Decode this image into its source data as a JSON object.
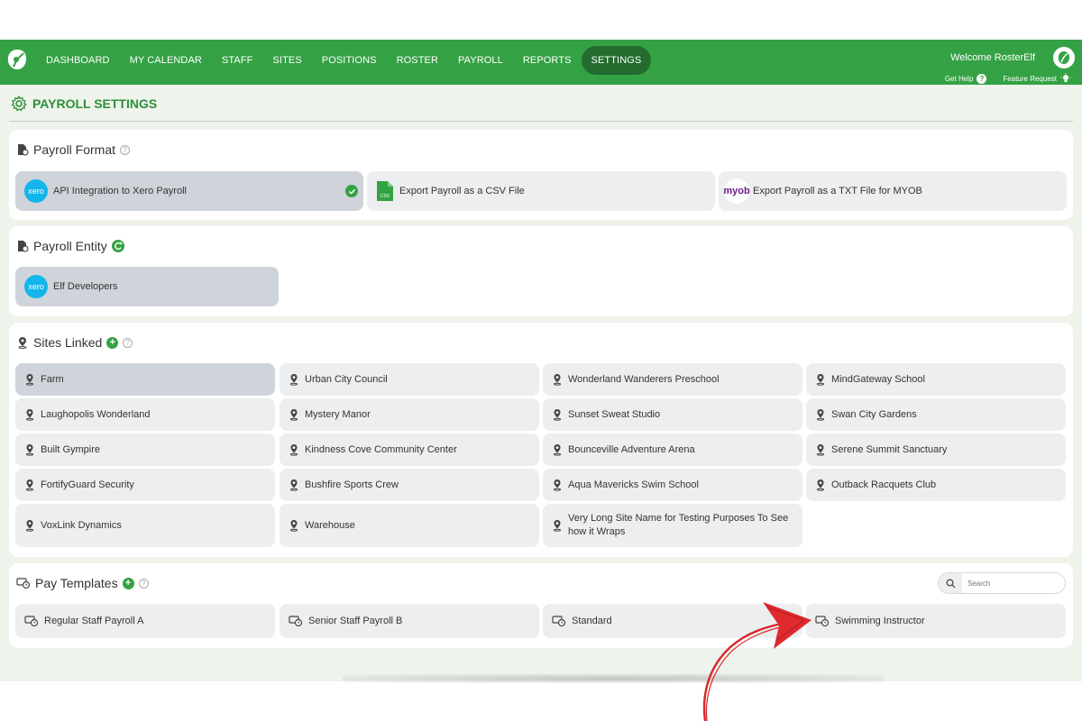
{
  "nav": {
    "items": [
      {
        "label": "DASHBOARD"
      },
      {
        "label": "MY CALENDAR"
      },
      {
        "label": "STAFF"
      },
      {
        "label": "SITES"
      },
      {
        "label": "POSITIONS"
      },
      {
        "label": "ROSTER"
      },
      {
        "label": "PAYROLL"
      },
      {
        "label": "REPORTS"
      },
      {
        "label": "SETTINGS"
      }
    ],
    "active": "SETTINGS",
    "welcome": "Welcome RosterElf",
    "get_help": "Get Help",
    "feature_request": "Feature Request"
  },
  "page": {
    "title": "PAYROLL SETTINGS"
  },
  "payroll_format": {
    "heading": "Payroll Format",
    "options": [
      {
        "label": "API Integration to Xero Payroll",
        "badge": "xero",
        "selected": true
      },
      {
        "label": "Export Payroll as a CSV File",
        "badge": "CSV",
        "selected": false
      },
      {
        "label": "Export Payroll as a TXT File for MYOB",
        "badge": "myob",
        "selected": false
      }
    ]
  },
  "payroll_entity": {
    "heading": "Payroll Entity",
    "entity": {
      "label": "Elf Developers",
      "badge": "xero"
    }
  },
  "sites_linked": {
    "heading": "Sites Linked",
    "sites": [
      {
        "label": "Farm"
      },
      {
        "label": "Urban City Council"
      },
      {
        "label": "Wonderland Wanderers Preschool"
      },
      {
        "label": "MindGateway School"
      },
      {
        "label": "Laughopolis Wonderland"
      },
      {
        "label": "Mystery Manor"
      },
      {
        "label": "Sunset Sweat Studio"
      },
      {
        "label": "Swan City Gardens"
      },
      {
        "label": "Built Gympire"
      },
      {
        "label": "Kindness Cove Community Center"
      },
      {
        "label": "Bounceville Adventure Arena"
      },
      {
        "label": "Serene Summit Sanctuary"
      },
      {
        "label": "FortifyGuard Security"
      },
      {
        "label": "Bushfire Sports Crew"
      },
      {
        "label": "Aqua Mavericks Swim School"
      },
      {
        "label": "Outback Racquets Club"
      },
      {
        "label": "VoxLink Dynamics"
      },
      {
        "label": "Warehouse"
      },
      {
        "label": "Very Long Site Name for Testing Purposes To See how it Wraps"
      }
    ]
  },
  "pay_templates": {
    "heading": "Pay Templates",
    "search_placeholder": "Search",
    "templates": [
      {
        "label": "Regular Staff Payroll A"
      },
      {
        "label": "Senior Staff Payroll B"
      },
      {
        "label": "Standard"
      },
      {
        "label": "Swimming Instructor"
      }
    ]
  },
  "colors": {
    "brand_green": "#34a244",
    "active_nav": "#236b2e",
    "xero_blue": "#13b5ea",
    "myob_purple": "#6b1d8c",
    "annotation_arrow": "#d8262a"
  }
}
